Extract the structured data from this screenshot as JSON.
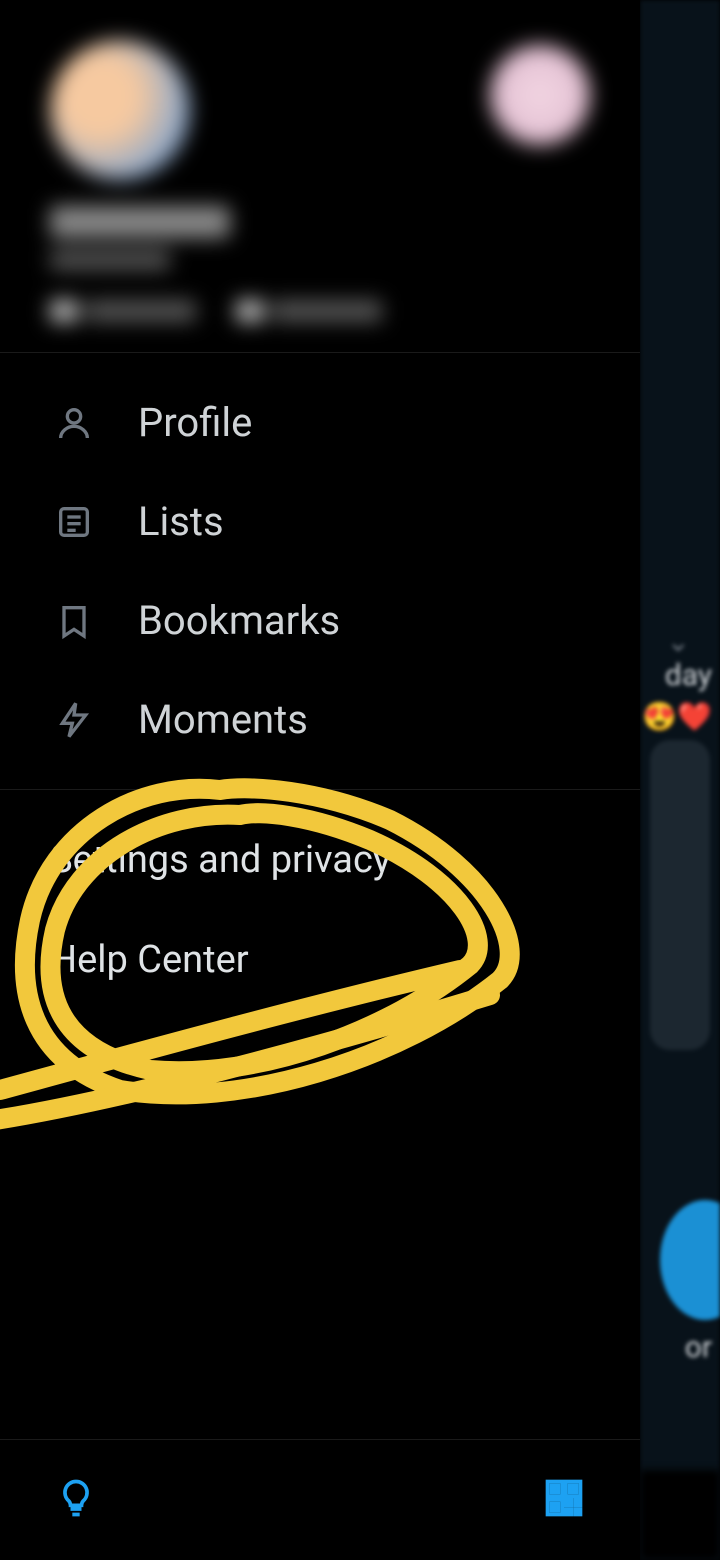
{
  "menu": {
    "items": [
      {
        "label": "Profile"
      },
      {
        "label": "Lists"
      },
      {
        "label": "Bookmarks"
      },
      {
        "label": "Moments"
      }
    ]
  },
  "secondary": {
    "settings": "Settings and privacy",
    "help": "Help Center"
  },
  "background": {
    "text1": "day",
    "text2": "or"
  }
}
